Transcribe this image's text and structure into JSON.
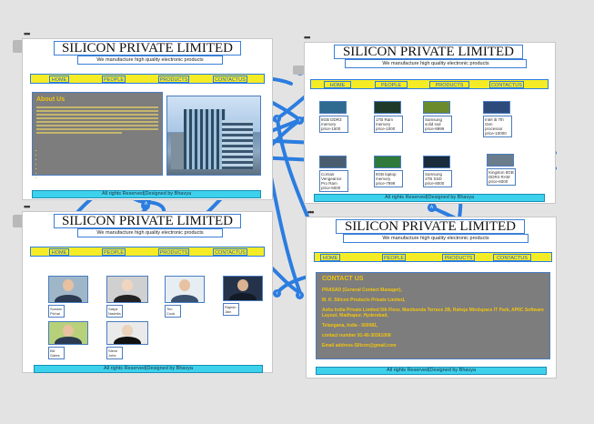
{
  "colors": {
    "wire": "#2b7de0",
    "menu": "#f5ec26",
    "footer": "#3dd1ec",
    "panel": "#7d7d7d",
    "accent_text": "#f1c40f"
  },
  "dots": "•••",
  "company": {
    "title": "SILICON PRIVATE LIMITED",
    "subtitle": "We manufacture high quality electronic products",
    "footer": "All rights Reserved|Designed by Bhavya"
  },
  "menu": {
    "home": "HOME",
    "people": "PEOPLE",
    "products": "PRODUCTS",
    "contact": "CONTACTUS"
  },
  "about": {
    "heading": "About Us"
  },
  "products": [
    {
      "caption": "8GB DDR3 memory price-1500",
      "color": "#2f6a8f"
    },
    {
      "caption": "1TB Ram memory price-1000",
      "color": "#1f3a28"
    },
    {
      "caption": "Samsung solid ssd price-8999",
      "color": "#6a8a2c"
    },
    {
      "caption": "Intel i5 7th Gen processor price-10000",
      "color": "#2c4a7a"
    },
    {
      "caption": "Corsair Vengeance Pro Ram price-5000",
      "color": "#4a5d6e"
    },
    {
      "caption": "8GB laptop memory price-7999",
      "color": "#2f7a3a"
    },
    {
      "caption": "Samsung 1TB SSD price-8000",
      "color": "#1a2b3c"
    },
    {
      "caption": "Kingston 8GB DDR4 RAM price-6000",
      "color": "#6b7d8c"
    }
  ],
  "people": [
    {
      "caption": "Sundar Pichai"
    },
    {
      "caption": "Satya Nadella"
    },
    {
      "caption": "Tim Cook"
    },
    {
      "caption": "Rajesh Jain"
    },
    {
      "caption": "Bill Gates"
    },
    {
      "caption": "Steve Jobs"
    }
  ],
  "contact": {
    "heading": "CONTACT US",
    "line1": "PRASAD (General Contact Manager),",
    "line2": "M. K. Silicon Products Private Limited,",
    "line3": "Ashu India Private Limited 5th Floor, Manikonda Terrace 2B, Raheja Mindspace IT Park, APIIC Software Layout, Madhapur, Hyderabad,",
    "line4": "Telangana, India - 500081,",
    "line5": "contact number 91-40-30361008",
    "line6": "Email address-Silicon@gmail.com"
  }
}
